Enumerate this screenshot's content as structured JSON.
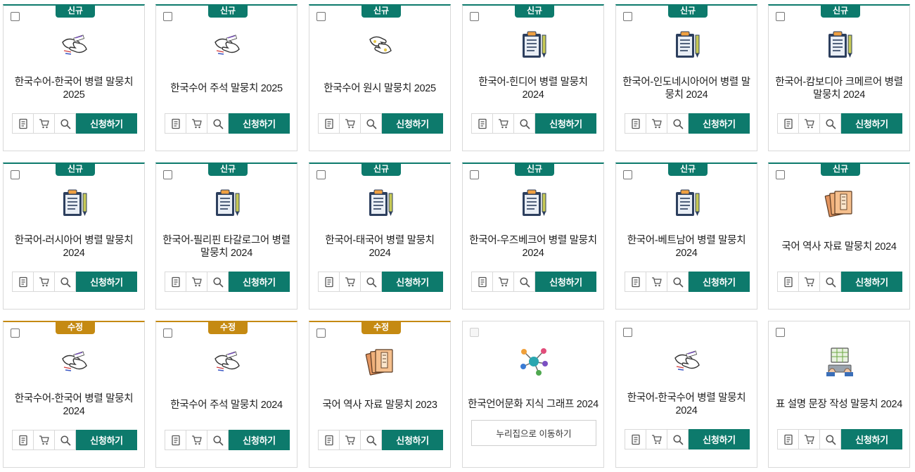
{
  "ui": {
    "apply_label": "신청하기",
    "badge_new": "신규",
    "badge_mod": "수정",
    "link_label": "누리집으로 이동하기"
  },
  "cards": [
    {
      "title": "한국수어-한국어 병렬 말뭉치 2025",
      "badge": "신규",
      "icon": "sign-language-hands-icon",
      "action": "apply"
    },
    {
      "title": "한국수어 주석 말뭉치 2025",
      "badge": "신규",
      "icon": "sign-language-hands-icon",
      "action": "apply"
    },
    {
      "title": "한국수어 원시 말뭉치 2025",
      "badge": "신규",
      "icon": "hands-outline-icon",
      "action": "apply"
    },
    {
      "title": "한국어-힌디어 병렬 말뭉치 2024",
      "badge": "신규",
      "icon": "clipboard-pencil-icon",
      "action": "apply"
    },
    {
      "title": "한국어-인도네시아어어 병렬 말뭉치 2024",
      "badge": "신규",
      "icon": "clipboard-pencil-icon",
      "action": "apply"
    },
    {
      "title": "한국어-캄보디아 크메르어 병렬 말뭉치 2024",
      "badge": "신규",
      "icon": "clipboard-pencil-icon",
      "action": "apply"
    },
    {
      "title": "한국어-러시아어 병렬 말뭉치 2024",
      "badge": "신규",
      "icon": "clipboard-pencil-icon",
      "action": "apply"
    },
    {
      "title": "한국어-필리핀 타갈로그어 병렬 말뭉치 2024",
      "badge": "신규",
      "icon": "clipboard-pencil-icon",
      "action": "apply"
    },
    {
      "title": "한국어-태국어 병렬 말뭉치 2024",
      "badge": "신규",
      "icon": "clipboard-pencil-icon",
      "action": "apply"
    },
    {
      "title": "한국어-우즈베크어 병렬 말뭉치 2024",
      "badge": "신규",
      "icon": "clipboard-pencil-icon",
      "action": "apply"
    },
    {
      "title": "한국어-베트남어 병렬 말뭉치 2024",
      "badge": "신규",
      "icon": "clipboard-pencil-icon",
      "action": "apply"
    },
    {
      "title": "국어 역사 자료 말뭉치 2024",
      "badge": "신규",
      "icon": "old-book-icon",
      "action": "apply"
    },
    {
      "title": "한국수어-한국어 병렬 말뭉치 2024",
      "badge": "수정",
      "icon": "sign-language-hands-icon",
      "action": "apply"
    },
    {
      "title": "한국수어 주석 말뭉치 2024",
      "badge": "수정",
      "icon": "sign-language-hands-icon",
      "action": "apply"
    },
    {
      "title": "국어 역사 자료 말뭉치 2023",
      "badge": "수정",
      "icon": "old-book-icon",
      "action": "apply"
    },
    {
      "title": "한국언어문화 지식 그래프 2024",
      "badge": "",
      "icon": "knowledge-graph-icon",
      "action": "link"
    },
    {
      "title": "한국어-한국수어 병렬 말뭉치 2024",
      "badge": "",
      "icon": "sign-language-hands-icon",
      "action": "apply"
    },
    {
      "title": "표 설명 문장 작성 말뭉치 2024",
      "badge": "",
      "icon": "typing-table-icon",
      "action": "apply"
    }
  ],
  "colors": {
    "accent": "#0d7a6c",
    "modified": "#c58a12"
  }
}
